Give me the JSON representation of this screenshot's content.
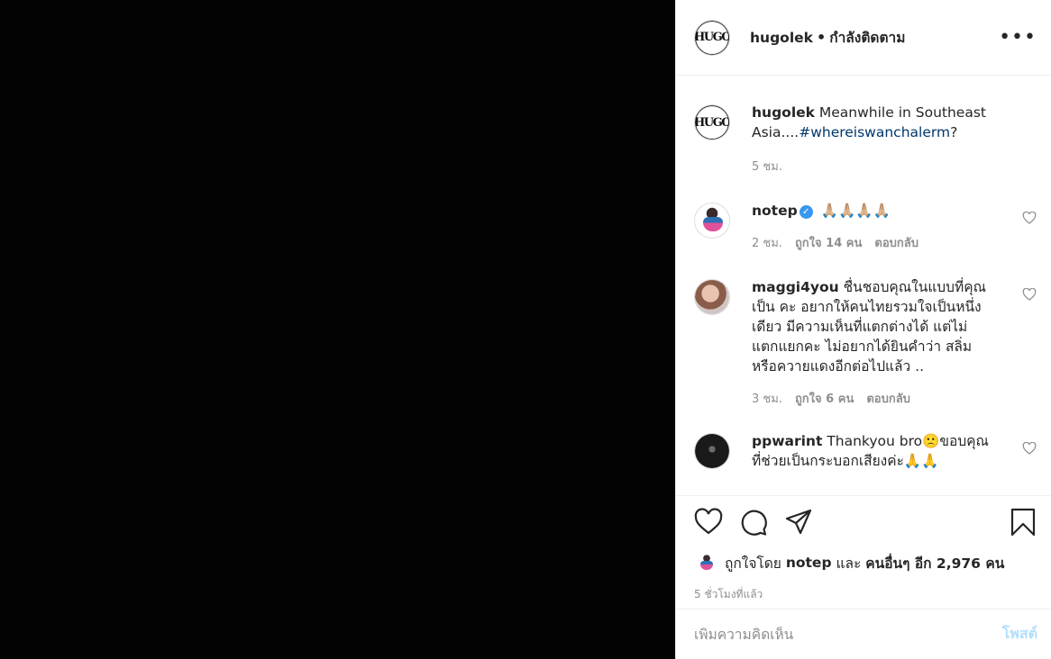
{
  "post": {
    "username": "hugolek",
    "follow_status": "กำลังติดตาม",
    "dot": "•",
    "more_icon": "•••"
  },
  "caption": {
    "username": "hugolek",
    "text": "Meanwhile in Southeast Asia....",
    "hashtag": "#whereiswanchalerm",
    "suffix": "?",
    "time": "5 ชม."
  },
  "comments": [
    {
      "username": "notep",
      "verified": true,
      "text": "🙏🏼🙏🏼🙏🏼🙏🏼",
      "time": "2 ชม.",
      "likes": "ถูกใจ 14 คน",
      "reply": "ตอบกลับ"
    },
    {
      "username": "maggi4you",
      "verified": false,
      "text": "ชื่นชอบคุณในแบบที่คุณเป็น คะ อยากให้คนไทยรวมใจเป็นหนึ่งเดียว มีความเห็นที่แตกต่างได้ แต่ไม่แตกแยกคะ ไม่อยากได้ยินคำว่า สลิ่มหรือควายแดงอีกต่อไปแล้ว ..",
      "time": "3 ชม.",
      "likes": "ถูกใจ 6 คน",
      "reply": "ตอบกลับ"
    },
    {
      "username": "ppwarint",
      "verified": false,
      "text": "Thankyou bro🙁ขอบคุณที่ช่วยเป็นกระบอกเสียงค่ะ🙏🙏",
      "time": "",
      "likes": "",
      "reply": ""
    }
  ],
  "likes_line": {
    "prefix": "ถูกใจโดย",
    "user": "notep",
    "and": "และ",
    "others": "คนอื่นๆ อีก 2,976 คน"
  },
  "time_ago": "5 ชั่วโมงที่แล้ว",
  "add_comment": {
    "placeholder": "เพิ่มความคิดเห็น",
    "post_label": "โพสต์"
  },
  "icons": {
    "like": "heart-icon",
    "comment": "comment-icon",
    "share": "share-icon",
    "save": "bookmark-icon",
    "more": "more-icon"
  }
}
